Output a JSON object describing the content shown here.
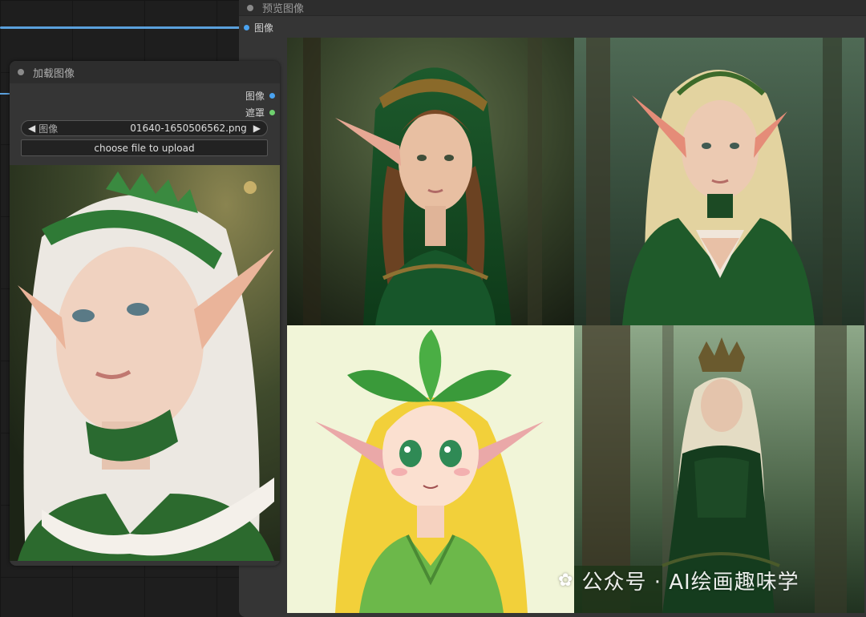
{
  "preview_node": {
    "title": "预览图像",
    "input_label": "图像"
  },
  "load_node": {
    "title": "加载图像",
    "outputs": [
      "图像",
      "遮罩"
    ],
    "image_label": "图像",
    "image_value": "01640-1650506562.png",
    "upload_label": "choose file to upload"
  },
  "watermark": "公众号 · AI绘画趣味学",
  "colors": {
    "image_port": "#4aa3f0",
    "mask_port": "#6fd06f",
    "wire": "#5aa0dc"
  }
}
